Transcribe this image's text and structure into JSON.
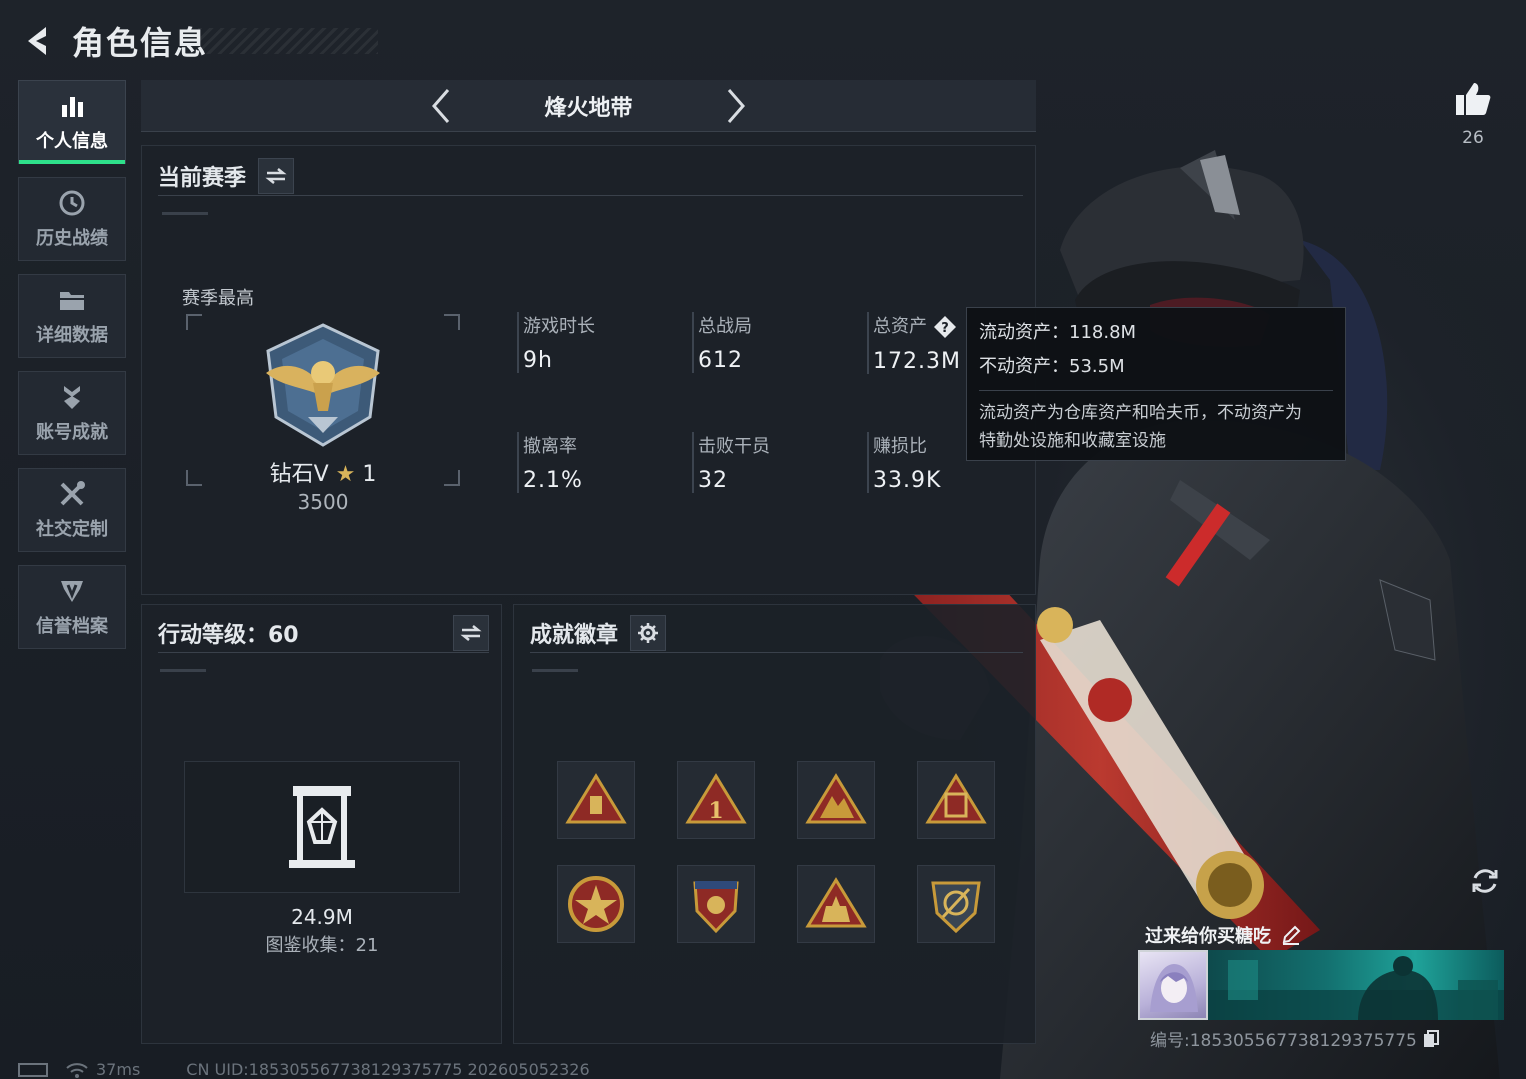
{
  "header": {
    "title": "角色信息"
  },
  "sidebar": {
    "items": [
      {
        "label": "个人信息",
        "active": true
      },
      {
        "label": "历史战绩",
        "active": false
      },
      {
        "label": "详细数据",
        "active": false
      },
      {
        "label": "账号成就",
        "active": false
      },
      {
        "label": "社交定制",
        "active": false
      },
      {
        "label": "信誉档案",
        "active": false
      }
    ]
  },
  "mode": {
    "title": "烽火地带"
  },
  "season": {
    "title": "当前赛季",
    "best_label": "赛季最高",
    "rank": "钻石V",
    "stars": "1",
    "score": "3500",
    "stats": [
      {
        "label": "游戏时长",
        "value": "9h"
      },
      {
        "label": "总战局",
        "value": "612"
      },
      {
        "label": "总资产",
        "value": "172.3M"
      },
      {
        "label": "撤离率",
        "value": "2.1%"
      },
      {
        "label": "击败干员",
        "value": "32"
      },
      {
        "label": "赚损比",
        "value": "33.9K"
      }
    ]
  },
  "tooltip": {
    "liquid": "流动资产：118.8M",
    "fixed": "不动资产：53.5M",
    "desc_line1": "流动资产为仓库资产和哈夫币，不动资产为",
    "desc_line2": "特勤处设施和收藏室设施"
  },
  "action_level": {
    "title": "行动等级：60",
    "collection_value": "24.9M",
    "collection_label": "图鉴收集：21"
  },
  "badges": {
    "title": "成就徽章",
    "items": [
      "badge-1",
      "badge-2",
      "badge-3",
      "badge-4",
      "badge-5",
      "badge-6",
      "badge-7",
      "badge-8"
    ]
  },
  "profile": {
    "likes": "26",
    "signature": "过来给你买糖吃",
    "id_text": "编号:185305567738129375775"
  },
  "status_bar": {
    "ping": "37ms",
    "uid": "CN UID:185305567738129375775 202605052326"
  },
  "colors": {
    "accent": "#2ee08a",
    "background": "#1a1f26",
    "panel": "#1c2128",
    "badge_gold": "#c89a3a",
    "badge_red": "#8e2a25"
  }
}
